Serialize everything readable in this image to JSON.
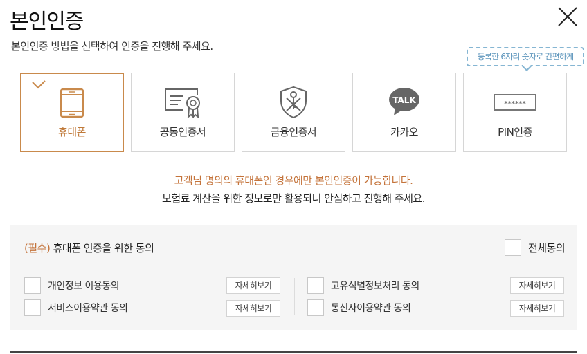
{
  "header": {
    "title": "본인인증",
    "subtitle": "본인인증 방법을 선택하여 인증을 진행해 주세요."
  },
  "tooltip": "등록한 6자리 숫자로 간편하게",
  "methods": [
    {
      "label": "휴대폰",
      "icon": "mobile-phone-icon",
      "selected": true
    },
    {
      "label": "공동인증서",
      "icon": "certificate-icon",
      "selected": false
    },
    {
      "label": "금융인증서",
      "icon": "financial-certificate-icon",
      "selected": false
    },
    {
      "label": "카카오",
      "icon": "kakao-talk-icon",
      "icon_text": "TALK",
      "selected": false
    },
    {
      "label": "PIN인증",
      "icon": "pin-input-icon",
      "icon_text": "******",
      "selected": false
    }
  ],
  "notice": {
    "line1": "고객님 명의의 휴대폰인 경우에만 본인인증이 가능합니다.",
    "line2": "보험료 계산을 위한 정보로만 활용되니 안심하고 진행해 주세요."
  },
  "agreement": {
    "title_required": "(필수)",
    "title_text": " 휴대폰 인증을 위한 동의",
    "all_agree_label": "전체동의",
    "detail_label": "자세히보기",
    "items": [
      {
        "label": "개인정보 이용동의",
        "checked": false
      },
      {
        "label": "서비스이용약관 동의",
        "checked": false
      },
      {
        "label": "고유식별정보처리 동의",
        "checked": false
      },
      {
        "label": "통신사이용약관 동의",
        "checked": false
      }
    ]
  },
  "colors": {
    "accent": "#c98a4c",
    "notice": "#c4733a",
    "tooltip": "#86b6d3"
  }
}
